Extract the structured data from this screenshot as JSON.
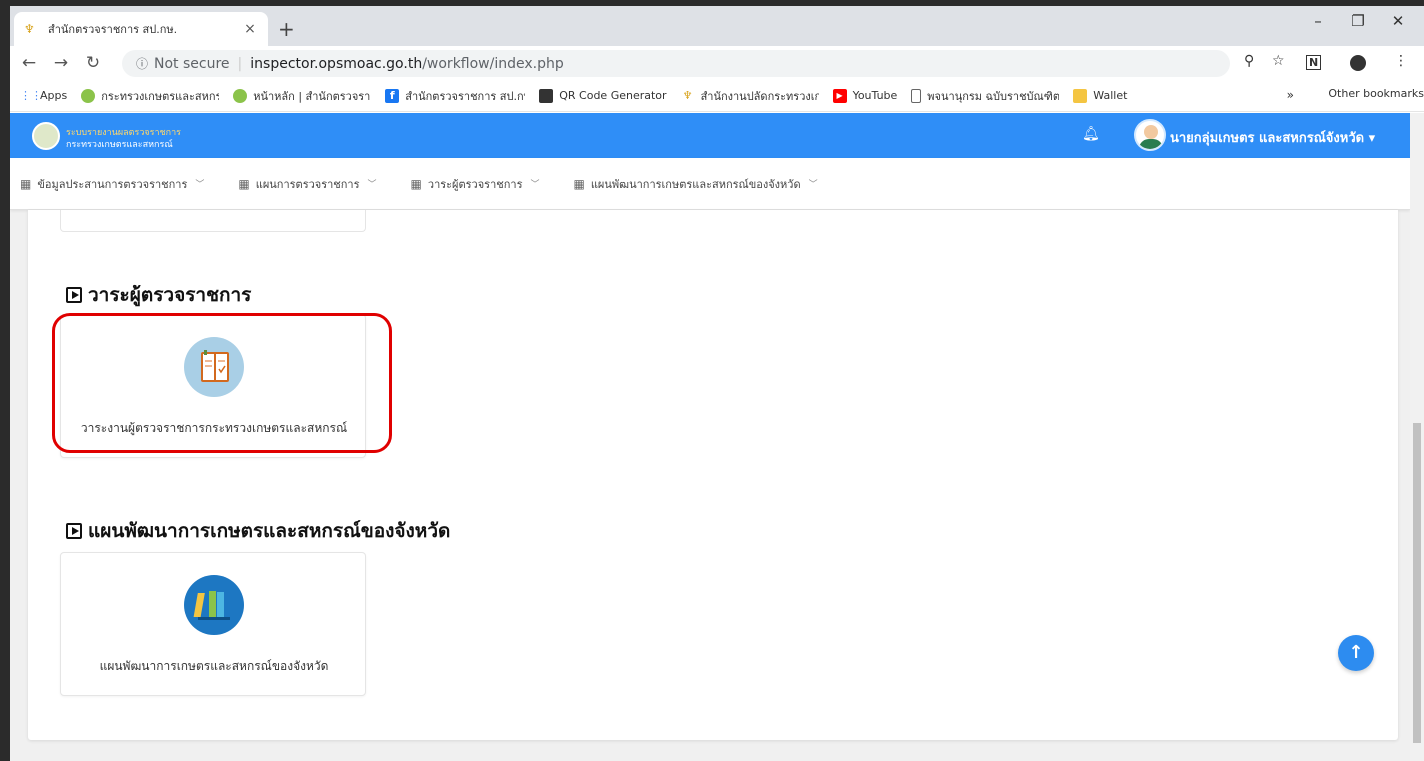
{
  "browser": {
    "tab_title": "สำนักตรวจราชการ สป.กษ.",
    "url_prefix": "Not secure",
    "url_host": "inspector.opsmoac.go.th",
    "url_path": "/workflow/index.php",
    "bookmarks": [
      {
        "label": "Apps",
        "icon": "apps-grid-icon",
        "color": "#4285f4"
      },
      {
        "label": "กระทรวงเกษตรและสหกรณ์",
        "icon": "moac-logo-icon",
        "color": "#4caf50"
      },
      {
        "label": "หน้าหลัก | สำนักตรวจราชการ",
        "icon": "moac-logo-icon",
        "color": "#4caf50"
      },
      {
        "label": "สำนักตรวจราชการ สป.กษ.",
        "icon": "facebook-icon",
        "color": "#1877f2"
      },
      {
        "label": "QR Code Generator",
        "icon": "qr-icon",
        "color": "#333333"
      },
      {
        "label": "สำนักงานปลัดกระทรวงเกษตรและสหกรณ์",
        "icon": "ops-logo-icon",
        "color": "#d9a520"
      },
      {
        "label": "YouTube",
        "icon": "youtube-icon",
        "color": "#ff0000"
      },
      {
        "label": "พจนานุกรม ฉบับราชบัณฑิตยสถาน",
        "icon": "page-icon",
        "color": "#666666"
      },
      {
        "label": "Wallet",
        "icon": "folder-icon",
        "color": "#f4c542"
      }
    ],
    "bookmarks_more": "»",
    "other_bookmarks": "Other bookmarks"
  },
  "app": {
    "logo_line1": "ระบบรายงานผลตรวจราชการ",
    "logo_line2": "กระทรวงเกษตรและสหกรณ์",
    "user_name": "นายกลุ่มเกษตร และสหกรณ์จังหวัด",
    "accent_color": "#2f8ef7",
    "menu": [
      {
        "label": "ข้อมูลประสานการตรวจราชการ"
      },
      {
        "label": "แผนการตรวจราชการ"
      },
      {
        "label": "วาระผู้ตรวจราชการ"
      },
      {
        "label": "แผนพัฒนาการเกษตรและสหกรณ์ของจังหวัด"
      }
    ]
  },
  "sections": [
    {
      "heading": "วาระผู้ตรวจราชการ",
      "card_label": "วาระงานผู้ตรวจราชการกระทรวงเกษตรและสหกรณ์",
      "icon": "notebook-icon",
      "highlighted": true
    },
    {
      "heading": "แผนพัฒนาการเกษตรและสหกรณ์ของจังหวัด",
      "card_label": "แผนพัฒนาการเกษตรและสหกรณ์ของจังหวัด",
      "icon": "binders-icon",
      "highlighted": false
    }
  ],
  "highlight_color": "#e00000"
}
